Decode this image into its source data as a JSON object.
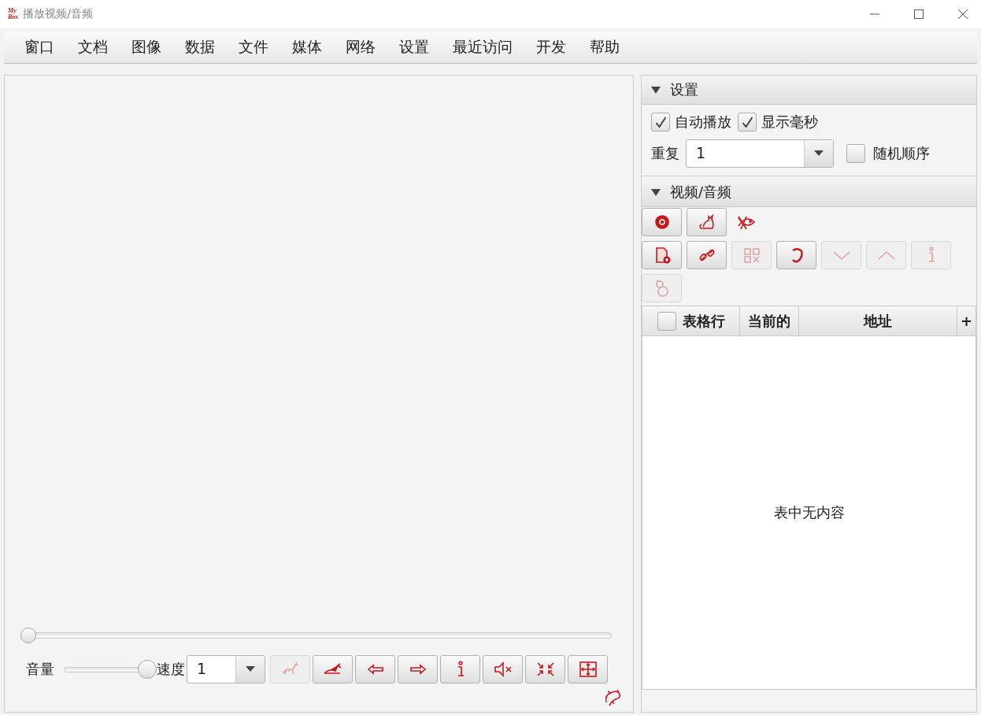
{
  "window": {
    "title": "播放视频/音频",
    "logo": [
      "My",
      "Box"
    ]
  },
  "menu": [
    {
      "label": "窗口"
    },
    {
      "label": "文档"
    },
    {
      "label": "图像"
    },
    {
      "label": "数据"
    },
    {
      "label": "文件"
    },
    {
      "label": "媒体"
    },
    {
      "label": "网络"
    },
    {
      "label": "设置"
    },
    {
      "label": "最近访问"
    },
    {
      "label": "开发"
    },
    {
      "label": "帮助"
    }
  ],
  "player": {
    "position": {
      "level": 0
    },
    "volume_label": "音量",
    "volume": {
      "level": 1
    },
    "speed_label": "速度",
    "speed": {
      "value": "1"
    },
    "buttons": [
      {
        "disabled": true
      },
      {
        "disabled": false
      },
      {
        "disabled": false
      },
      {
        "disabled": false
      },
      {
        "disabled": false
      },
      {
        "disabled": false
      },
      {
        "disabled": false
      },
      {
        "disabled": false
      }
    ]
  },
  "settings": {
    "title": "设置",
    "expanded": true,
    "options": [
      {
        "label": "自动播放",
        "checked": true
      },
      {
        "label": "显示毫秒",
        "checked": true
      }
    ],
    "repeat_label": "重复",
    "repeat": {
      "value": "1"
    },
    "random": {
      "label": "随机顺序",
      "checked": false
    }
  },
  "media": {
    "title": "视频/音频",
    "expanded": true,
    "tool_rows": [
      [
        {
          "kind": "button",
          "disabled": false
        },
        {
          "kind": "button",
          "disabled": false
        },
        {
          "kind": "plain",
          "disabled": false
        }
      ],
      [
        {
          "kind": "button",
          "disabled": false
        },
        {
          "kind": "button",
          "disabled": false
        },
        {
          "kind": "button",
          "disabled": true
        },
        {
          "kind": "button",
          "disabled": false
        },
        {
          "kind": "button",
          "disabled": true
        },
        {
          "kind": "button",
          "disabled": true
        },
        {
          "kind": "button",
          "disabled": true
        }
      ],
      [
        {
          "kind": "button",
          "disabled": true
        }
      ]
    ],
    "table": {
      "select_all": {
        "checked": false
      },
      "columns": [
        "表格行",
        "当前的",
        "地址"
      ],
      "add_column": "+",
      "empty": "表中无内容"
    }
  }
}
